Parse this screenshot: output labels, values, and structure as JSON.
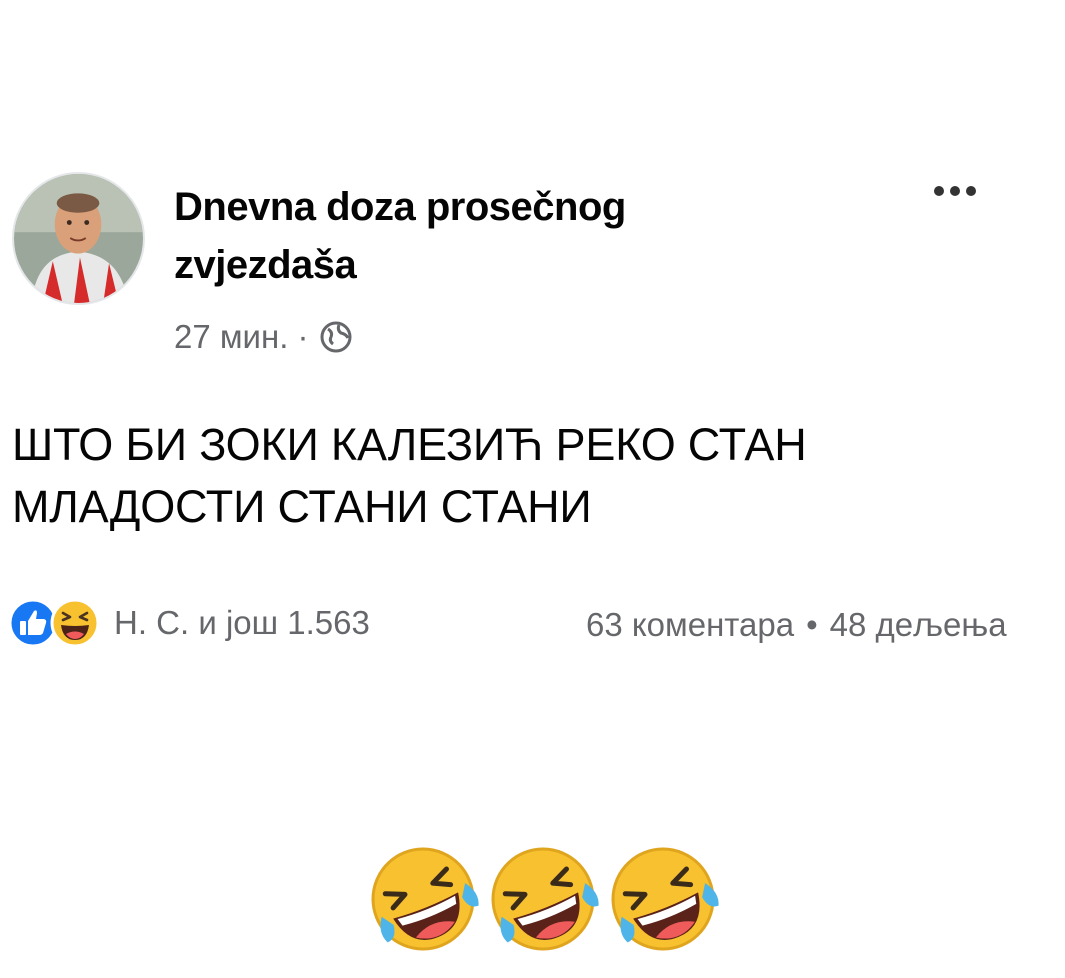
{
  "post": {
    "author": "Dnevna doza prosečnog zvjezdaša",
    "time": "27 мин. ·",
    "text": "ШТО БИ ЗОКИ КАЛЕЗИЋ РЕКО СТАН МЛАДОСТИ СТАНИ СТАНИ",
    "reactions_label": "Н. С. и још 1.563",
    "comments": "63 коментара",
    "separator": "•",
    "shares": "48 дељења",
    "reply_emojis": [
      "rolling-on-floor-laughing",
      "rolling-on-floor-laughing",
      "rolling-on-floor-laughing"
    ]
  },
  "colors": {
    "text": "#050505",
    "secondary": "#65676b",
    "like_blue": "#1877f2",
    "emoji_yellow": "#f7c12f"
  }
}
